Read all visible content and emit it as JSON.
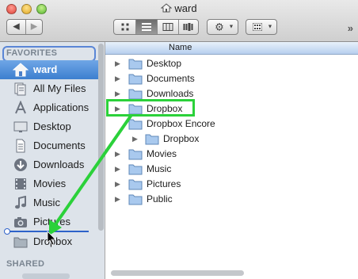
{
  "window": {
    "title": "ward"
  },
  "toolbar": {
    "back_icon": "back-arrow-icon",
    "forward_icon": "forward-arrow-icon",
    "views": [
      "icon-view",
      "list-view",
      "column-view",
      "coverflow-view"
    ],
    "action_icon": "gear-icon",
    "arrange_icon": "arrange-icon",
    "overflow_label": "»"
  },
  "sidebar": {
    "favorites_header": "FAVORITES",
    "shared_header": "SHARED",
    "items": [
      {
        "label": "ward",
        "icon": "home-icon",
        "selected": true
      },
      {
        "label": "All My Files",
        "icon": "all-files-icon"
      },
      {
        "label": "Applications",
        "icon": "applications-icon"
      },
      {
        "label": "Desktop",
        "icon": "desktop-icon"
      },
      {
        "label": "Documents",
        "icon": "documents-icon"
      },
      {
        "label": "Downloads",
        "icon": "downloads-icon"
      },
      {
        "label": "Movies",
        "icon": "movies-icon"
      },
      {
        "label": "Music",
        "icon": "music-icon"
      },
      {
        "label": "Pictures",
        "icon": "pictures-icon"
      },
      {
        "label": "Dropbox",
        "icon": "folder-icon"
      }
    ]
  },
  "list": {
    "column_name": "Name",
    "rows": [
      {
        "label": "Desktop",
        "level": 0,
        "disclosure": "▶"
      },
      {
        "label": "Documents",
        "level": 0,
        "disclosure": "▶"
      },
      {
        "label": "Downloads",
        "level": 0,
        "disclosure": "▶"
      },
      {
        "label": "Dropbox",
        "level": 0,
        "disclosure": "▶"
      },
      {
        "label": "Dropbox Encore",
        "level": 0,
        "disclosure": ""
      },
      {
        "label": "Dropbox",
        "level": 1,
        "disclosure": "▶"
      },
      {
        "label": "Movies",
        "level": 0,
        "disclosure": "▶"
      },
      {
        "label": "Music",
        "level": 0,
        "disclosure": "▶"
      },
      {
        "label": "Pictures",
        "level": 0,
        "disclosure": "▶"
      },
      {
        "label": "Public",
        "level": 0,
        "disclosure": "▶"
      }
    ]
  },
  "colors": {
    "highlight": "#2bd13a",
    "selection": "#3d7fcf",
    "drop_indicator": "#2e62c9"
  }
}
